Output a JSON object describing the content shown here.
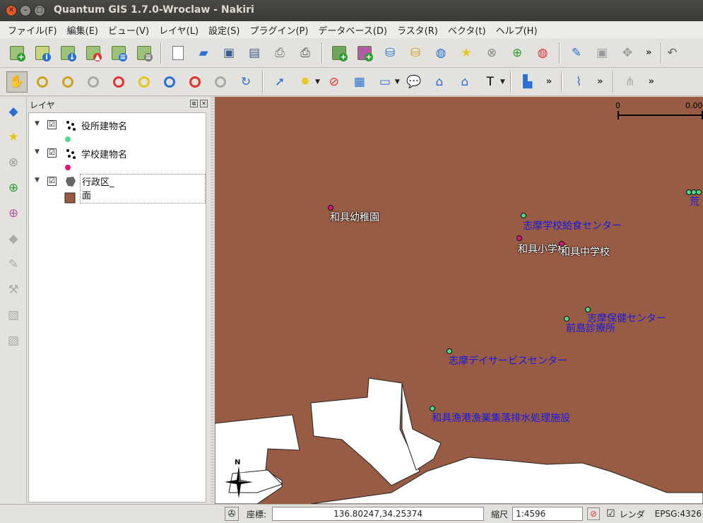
{
  "window": {
    "title": "Quantum GIS 1.7.0-Wroclaw - Nakiri"
  },
  "menu": [
    "ファイル(F)",
    "編集(E)",
    "ビュー(V)",
    "レイヤ(L)",
    "設定(S)",
    "プラグイン(P)",
    "データベース(D)",
    "ラスタ(R)",
    "ベクタ(t)",
    "ヘルプ(H)"
  ],
  "toolbar": {
    "more": "»"
  },
  "layers_panel": {
    "title": "レイヤ",
    "layers": [
      {
        "name": "役所建物名",
        "symbol_color": "#4ed88a",
        "checked": "☑"
      },
      {
        "name": "学校建物名",
        "symbol_color": "#e0157a",
        "checked": "☑"
      },
      {
        "name": "行政区_面",
        "symbol_color": "#985b44",
        "checked": "☑"
      }
    ]
  },
  "map": {
    "background": "#985b44",
    "scale_start": "0",
    "scale_end": "0.00",
    "labels": {
      "wagu_kindergarten": "和具幼稚園",
      "shima_lunch_center": "志摩学校給食センター",
      "wagu_elementary": "和具小学校",
      "wagu_junior_high": "和具中学校",
      "shima_health_center": "志摩保健センター",
      "maeshima_clinic": "前島診療所",
      "shima_day_service": "志摩デイサービスセンター",
      "wagu_fishing_port": "和具漁港漁業集落排水処理施設",
      "edge_label": "荒"
    },
    "north": "N"
  },
  "statusbar": {
    "coord_label": "座標:",
    "coord_value": "136.80247,34.25374",
    "scale_label": "縮尺",
    "scale_value": "1:4596",
    "render_label": "レンダ",
    "render_checked": "☑",
    "crs": "EPSG:4326"
  }
}
